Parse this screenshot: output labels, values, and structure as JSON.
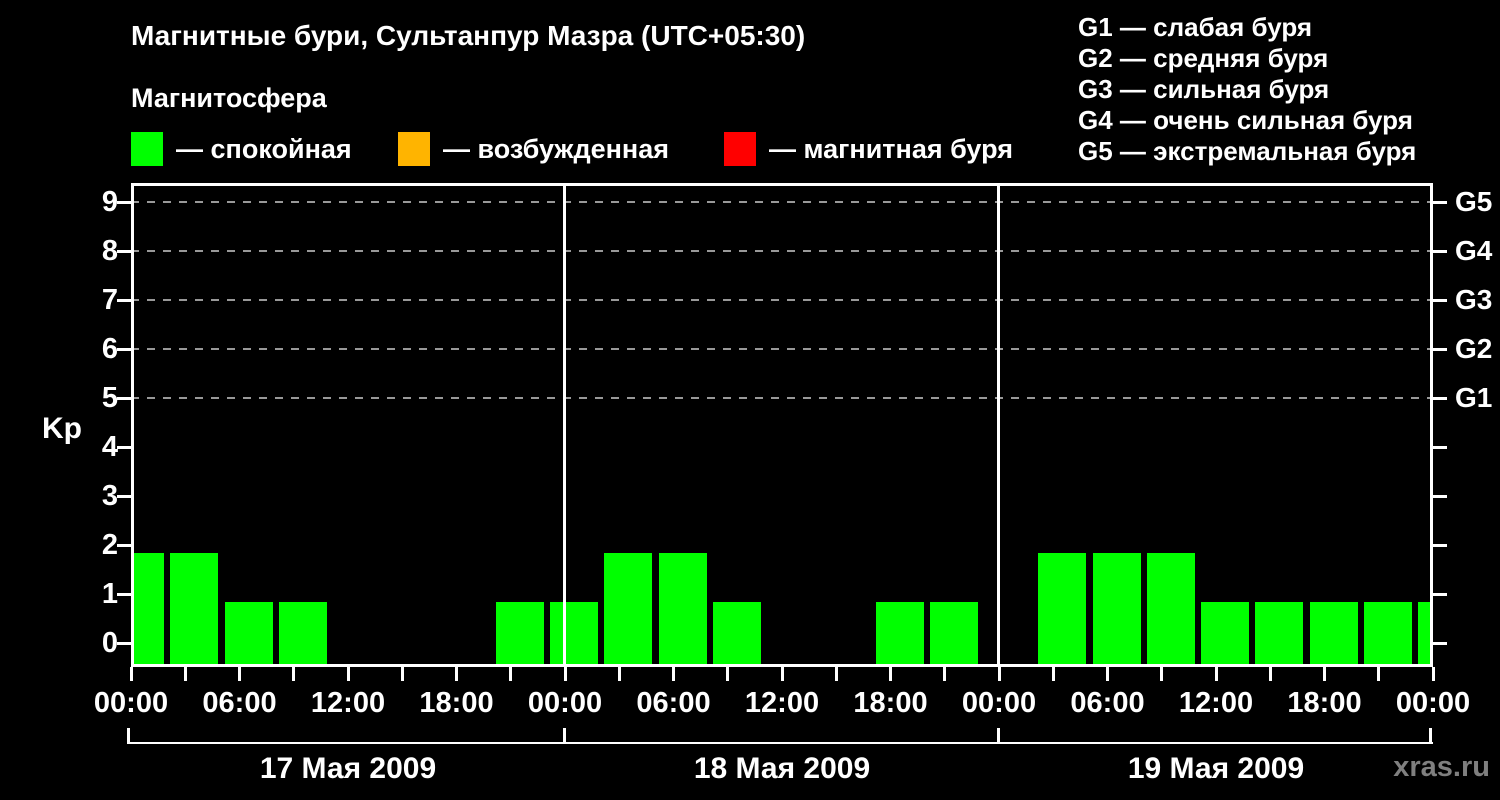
{
  "header": {
    "title": "Магнитные бури, Сультанпур Мазра (UTC+05:30)",
    "subtitle": "Магнитосфера",
    "legend": [
      {
        "color": "#00ff00",
        "label": "— спокойная"
      },
      {
        "color": "#ffb400",
        "label": "— возбужденная"
      },
      {
        "color": "#ff0000",
        "label": "— магнитная буря"
      }
    ],
    "storm_scale": [
      "G1 — слабая буря",
      "G2 — средняя буря",
      "G3 — сильная буря",
      "G4 — очень сильная буря",
      "G5 — экстремальная буря"
    ]
  },
  "chart_data": {
    "type": "bar",
    "title": "Магнитные бури, Сультанпур Мазра (UTC+05:30)",
    "ylabel": "Kp",
    "ylim": [
      -0.45,
      9.4
    ],
    "yticks": [
      0,
      1,
      2,
      3,
      4,
      5,
      6,
      7,
      8,
      9
    ],
    "grid": "dashed horizontal lines at storm levels Kp 5-9",
    "grid_levels": [
      {
        "kp": 5,
        "label": "G1"
      },
      {
        "kp": 6,
        "label": "G2"
      },
      {
        "kp": 7,
        "label": "G3"
      },
      {
        "kp": 8,
        "label": "G4"
      },
      {
        "kp": 9,
        "label": "G5"
      }
    ],
    "bar_color": "#00ff00",
    "bar_interval_hours": 3,
    "x_tick_interval_hours": 3,
    "x_label_interval_hours": 6,
    "x_labels": [
      "00:00",
      "06:00",
      "12:00",
      "18:00",
      "00:00",
      "06:00",
      "12:00",
      "18:00",
      "00:00",
      "06:00",
      "12:00",
      "18:00",
      "00:00"
    ],
    "days": [
      {
        "date": "17 Мая 2009",
        "kp_3h": [
          2,
          2,
          1,
          1,
          0,
          0,
          0,
          1
        ]
      },
      {
        "date": "18 Мая 2009",
        "kp_3h": [
          1,
          2,
          2,
          1,
          0,
          0,
          1,
          1
        ]
      },
      {
        "date": "19 Мая 2009",
        "kp_3h": [
          0,
          2,
          2,
          2,
          1,
          1,
          1,
          1
        ]
      }
    ],
    "next_day_first_bar_kp": 1,
    "legend_position": "top"
  },
  "footer": {
    "watermark": "xras.ru"
  }
}
